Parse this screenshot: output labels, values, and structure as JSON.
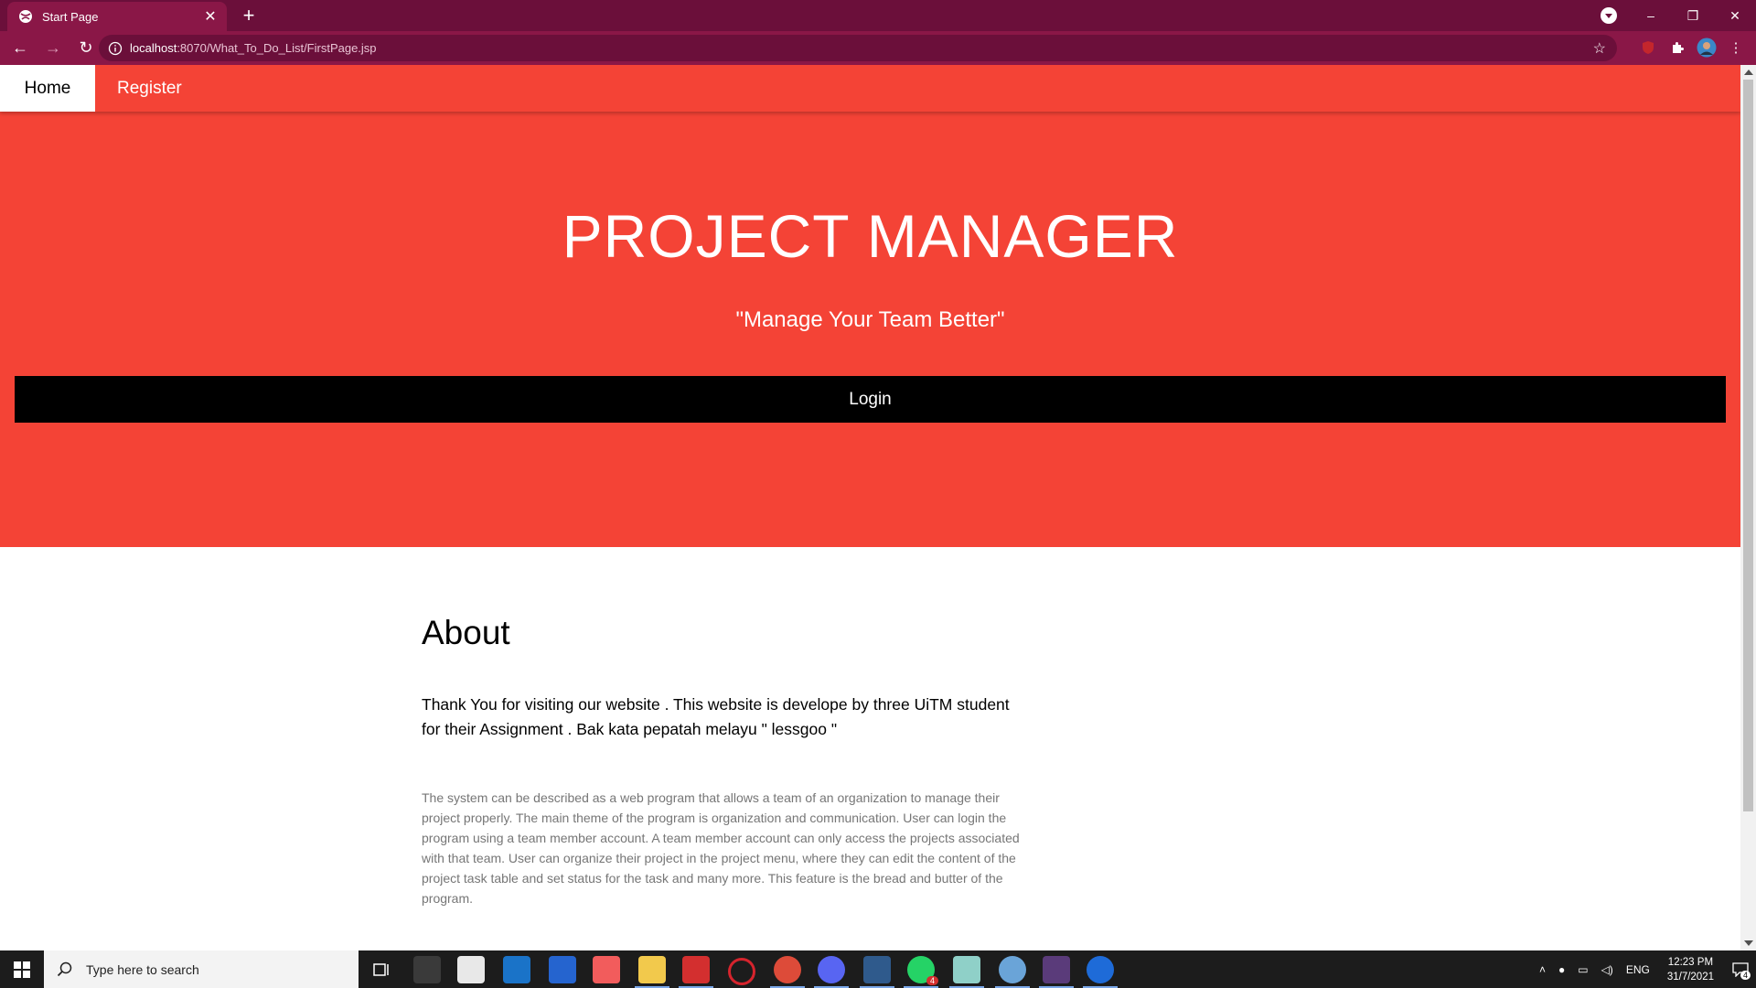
{
  "browser": {
    "tab_title": "Start Page",
    "url_host": "localhost",
    "url_path": ":8070/What_To_Do_List/FirstPage.jsp"
  },
  "nav": {
    "home": "Home",
    "register": "Register"
  },
  "hero": {
    "title": "PROJECT MANAGER",
    "subtitle": "\"Manage Your Team Better\"",
    "login": "Login"
  },
  "about": {
    "heading": "About",
    "lead": "Thank You for visiting our website . This website is develope by three UiTM student for their Assignment . Bak kata pepatah melayu \" lessgoo \"",
    "description": "The system can be described as a web program that allows a team of an organization to manage their project properly. The main theme of the program is organization and communication. User can login the program using a team member account. A team member account can only access the projects associated with that team. User can organize their project in the project menu, where they can edit the content of the project task table and set status for the task and many more. This feature is the bread and butter of the program."
  },
  "taskbar": {
    "search_placeholder": "Type here to search",
    "language": "ENG",
    "time": "12:23 PM",
    "date": "31/7/2021",
    "notification_count": "4",
    "whatsapp_badge": "4"
  },
  "colors": {
    "brand_red": "#f44336",
    "chrome_dark": "#6b0f3a",
    "chrome_mid": "#8a1747"
  }
}
